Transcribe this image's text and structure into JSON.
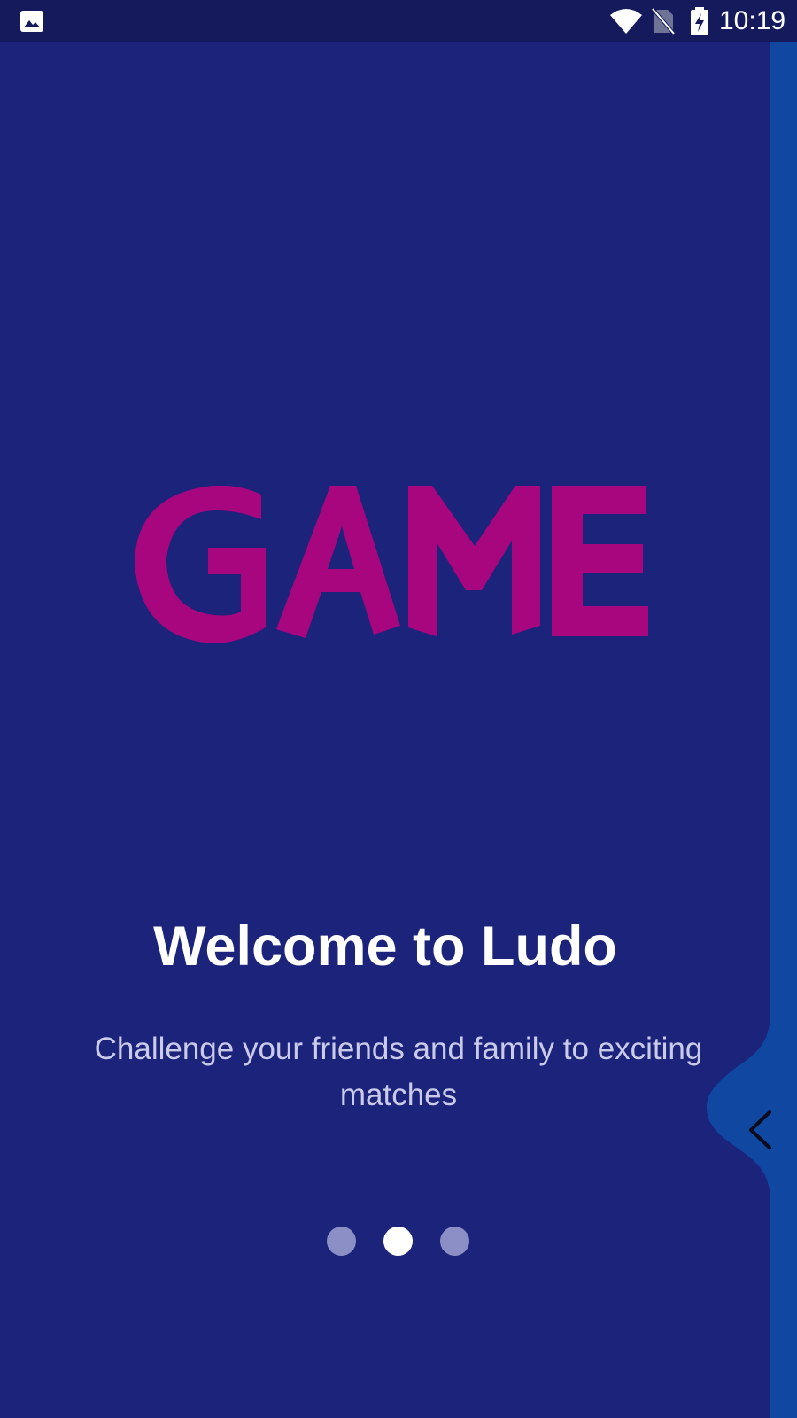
{
  "status_bar": {
    "time": "10:19",
    "icons": [
      "gallery-icon",
      "wifi-icon",
      "no-sim-icon",
      "battery-charging-icon"
    ]
  },
  "logo": {
    "text": "GAME",
    "color": "#a8067f"
  },
  "onboarding": {
    "title": "Welcome to Ludo",
    "subtitle": "Challenge your friends and family to exciting matches",
    "pages_total": 3,
    "current_page": 2
  },
  "drawer": {
    "handle_icon": "chevron-left-icon",
    "color": "#0f47a1"
  },
  "colors": {
    "background": "#1b237b",
    "status_bar": "#141a5c",
    "dot_inactive": "#8c8fc6",
    "dot_active": "#ffffff"
  }
}
